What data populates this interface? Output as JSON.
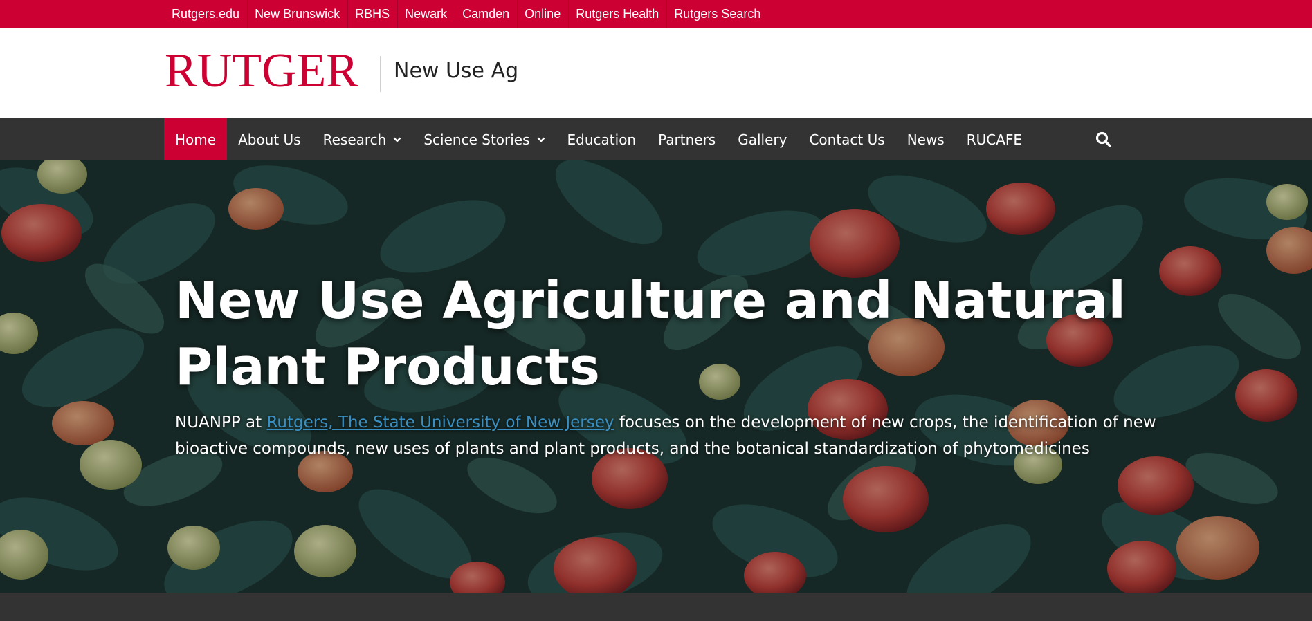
{
  "topbar": {
    "links": [
      "Rutgers.edu",
      "New Brunswick",
      "RBHS",
      "Newark",
      "Camden",
      "Online",
      "Rutgers Health",
      "Rutgers Search"
    ]
  },
  "header": {
    "logo_text": "RUTGERS",
    "site_name": "New Use Ag"
  },
  "nav": {
    "items": [
      {
        "label": "Home",
        "active": true
      },
      {
        "label": "About Us"
      },
      {
        "label": "Research",
        "dropdown": true
      },
      {
        "label": "Science Stories",
        "dropdown": true
      },
      {
        "label": "Education"
      },
      {
        "label": "Partners"
      },
      {
        "label": "Gallery"
      },
      {
        "label": "Contact Us"
      },
      {
        "label": "News"
      },
      {
        "label": "RUCAFE"
      }
    ],
    "search_icon": "search-icon"
  },
  "hero": {
    "title": "New Use Agriculture and Natural Plant Products",
    "text_prefix": "NUANPP at ",
    "link_text": "Rutgers, The State University of New Jersey",
    "text_suffix": " focuses on the development of new crops, the identification of new bioactive compounds, new uses of plants and plant products, and the botanical standardization of phytomedicines"
  },
  "colors": {
    "brand_red": "#cc0033",
    "nav_dark": "#333333",
    "link_blue": "#3a8fc2"
  }
}
